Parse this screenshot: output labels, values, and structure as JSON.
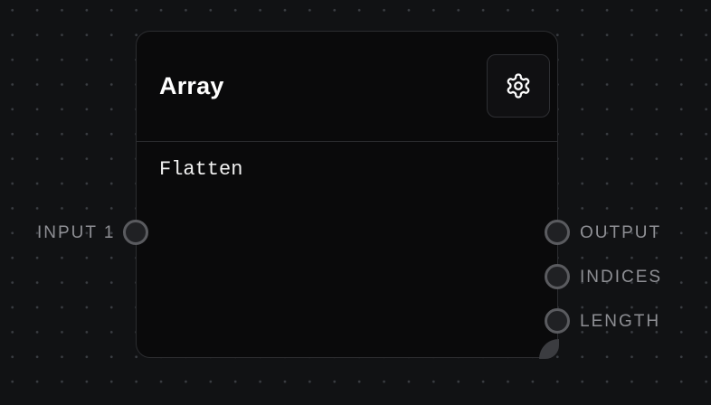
{
  "node": {
    "title": "Array",
    "operation": "Flatten",
    "settings_icon": "gear-icon"
  },
  "inputs": [
    {
      "label": "INPUT 1"
    }
  ],
  "outputs": [
    {
      "label": "OUTPUT"
    },
    {
      "label": "INDICES"
    },
    {
      "label": "LENGTH"
    }
  ],
  "colors": {
    "canvas_background": "#111214",
    "grid_dot": "#3a3d42",
    "node_background": "#0a0a0b",
    "node_border": "#2c2d30",
    "port_ring": "#5a5b5f",
    "port_label": "#8e8f94",
    "title_text": "#ffffff"
  }
}
